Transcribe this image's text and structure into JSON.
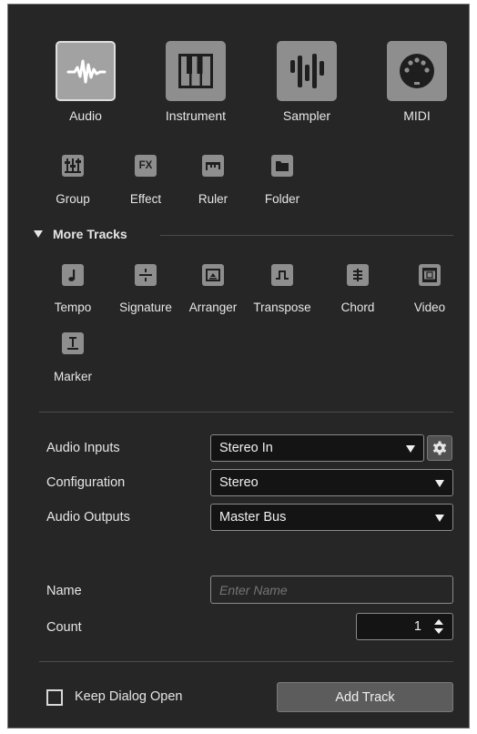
{
  "primary_tracks": [
    {
      "label": "Audio",
      "icon": "audio-waveform-icon",
      "selected": true
    },
    {
      "label": "Instrument",
      "icon": "piano-keys-icon",
      "selected": false
    },
    {
      "label": "Sampler",
      "icon": "sampler-bars-icon",
      "selected": false
    },
    {
      "label": "MIDI",
      "icon": "midi-connector-icon",
      "selected": false
    }
  ],
  "secondary_tracks": [
    {
      "label": "Group",
      "icon": "group-faders-icon"
    },
    {
      "label": "Effect",
      "icon": "fx-icon",
      "icon_text": "FX"
    },
    {
      "label": "Ruler",
      "icon": "ruler-icon"
    },
    {
      "label": "Folder",
      "icon": "folder-icon"
    }
  ],
  "more_tracks": {
    "header": "More Tracks",
    "expanded": true,
    "items": [
      {
        "label": "Tempo",
        "icon": "tempo-note-icon"
      },
      {
        "label": "Signature",
        "icon": "signature-divide-icon"
      },
      {
        "label": "Arranger",
        "icon": "arranger-icon"
      },
      {
        "label": "Transpose",
        "icon": "transpose-icon"
      },
      {
        "label": "Chord",
        "icon": "chord-icon"
      },
      {
        "label": "Video",
        "icon": "video-film-icon"
      },
      {
        "label": "Marker",
        "icon": "marker-icon"
      }
    ]
  },
  "audio_settings": {
    "inputs_label": "Audio Inputs",
    "inputs_value": "Stereo In",
    "configuration_label": "Configuration",
    "configuration_value": "Stereo",
    "outputs_label": "Audio Outputs",
    "outputs_value": "Master Bus"
  },
  "name_field": {
    "label": "Name",
    "value": "",
    "placeholder": "Enter Name"
  },
  "count_field": {
    "label": "Count",
    "value": "1"
  },
  "footer": {
    "keep_open_label": "Keep Dialog Open",
    "keep_open_checked": false,
    "add_button_label": "Add Track"
  },
  "colors": {
    "background": "#262626",
    "tile": "#8e8e8e",
    "tile_selected": "#a2a2a2",
    "icon_glyph": "#1e1e1e",
    "field_bg": "#141414"
  }
}
